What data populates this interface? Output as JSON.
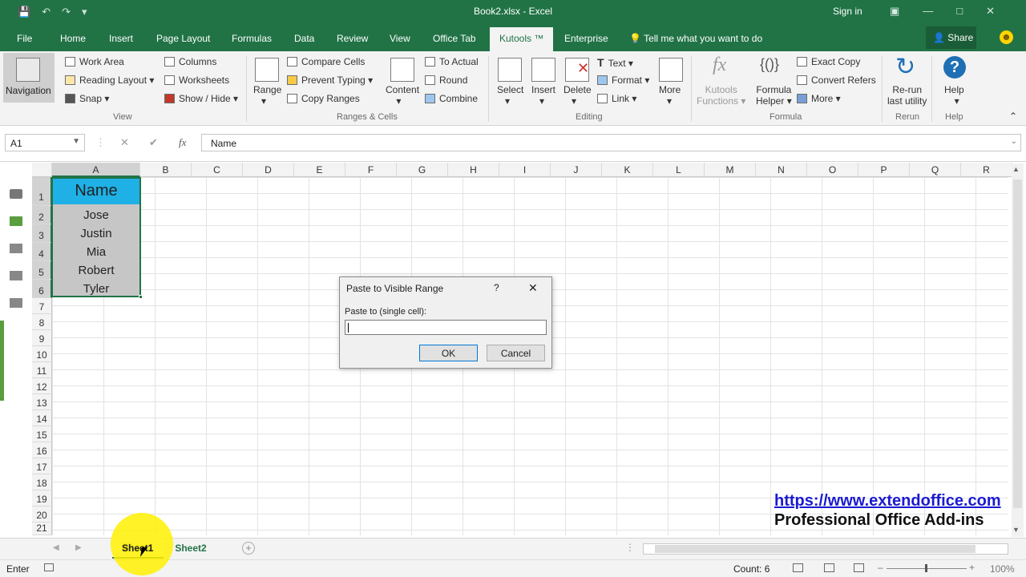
{
  "window": {
    "title": "Book2.xlsx  -  Excel",
    "signin": "Sign in",
    "qat_icons": [
      "save-icon",
      "undo-icon",
      "redo-icon",
      "customize-qat-icon"
    ]
  },
  "tabs": [
    "File",
    "Home",
    "Insert",
    "Page Layout",
    "Formulas",
    "Data",
    "Review",
    "View",
    "Office Tab",
    "Kutools ™",
    "Enterprise",
    "Tell me what you want to do"
  ],
  "active_tab": "Kutools ™",
  "share": "Share",
  "ribbon": {
    "view": {
      "navigation": "Navigation",
      "work_area": "Work Area",
      "reading_layout": "Reading Layout",
      "snap": "Snap",
      "columns": "Columns",
      "worksheets": "Worksheets",
      "show_hide": "Show / Hide",
      "label": "View"
    },
    "ranges": {
      "range": "Range",
      "compare": "Compare Cells",
      "prevent": "Prevent Typing",
      "copy": "Copy Ranges",
      "content": "Content",
      "to_actual": "To Actual",
      "round": "Round",
      "combine": "Combine",
      "label": "Ranges & Cells"
    },
    "editing": {
      "select": "Select",
      "insert": "Insert",
      "delete": "Delete",
      "text": "Text",
      "format": "Format",
      "link": "Link",
      "more": "More",
      "label": "Editing"
    },
    "formula": {
      "kutools1": "Kutools",
      "kutools2": "Functions",
      "helper1": "Formula",
      "helper2": "Helper",
      "exact": "Exact Copy",
      "convert": "Convert Refers",
      "more": "More",
      "label": "Formula"
    },
    "rerun": {
      "l1": "Re-run",
      "l2": "last utility",
      "label": "Rerun"
    },
    "help": {
      "l1": "Help",
      "label": "Help"
    }
  },
  "formula_bar": {
    "name_box": "A1",
    "formula": "Name",
    "cancel": "✕",
    "enter": "✔",
    "fx": "fx"
  },
  "columns": [
    "A",
    "B",
    "C",
    "D",
    "E",
    "F",
    "G",
    "H",
    "I",
    "J",
    "K",
    "L",
    "M",
    "N",
    "O",
    "P",
    "Q",
    "R"
  ],
  "rows": [
    "1",
    "2",
    "3",
    "4",
    "5",
    "6",
    "7",
    "8",
    "9",
    "10",
    "11",
    "12",
    "13",
    "14",
    "15",
    "16",
    "17",
    "18",
    "19",
    "20",
    "21"
  ],
  "cells": {
    "header": "Name",
    "names": [
      "Jose",
      "Justin",
      "Mia",
      "Robert",
      "Tyler"
    ]
  },
  "colors": {
    "excel_green": "#217346",
    "header_fill": "#1fb0e6",
    "selection_fill": "#c6c6c6"
  },
  "sheets": [
    "Sheet1",
    "Sheet2"
  ],
  "status": {
    "mode": "Enter",
    "count": "Count: 6",
    "zoom": "100%"
  },
  "dialog": {
    "title": "Paste to Visible Range",
    "help": "?",
    "close": "✕",
    "label": "Paste to (single cell):",
    "value": "",
    "ok": "OK",
    "cancel": "Cancel"
  },
  "watermark": {
    "url": "https://www.extendoffice.com",
    "tagline": "Professional Office Add-ins"
  }
}
